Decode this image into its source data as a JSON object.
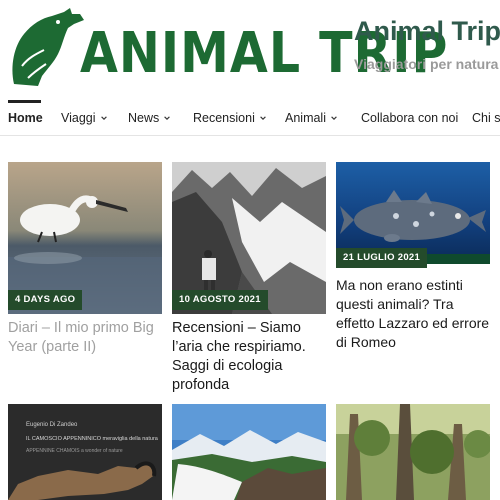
{
  "header": {
    "logo_text": "ANIMAL TRIP",
    "site_title": "Animal Trip",
    "tagline": "Viaggiatori per natura"
  },
  "nav": {
    "items": [
      {
        "label": "Home",
        "active": true,
        "dropdown": false
      },
      {
        "label": "Viaggi",
        "dropdown": true
      },
      {
        "label": "News",
        "dropdown": true
      },
      {
        "label": "Recensioni",
        "dropdown": true
      },
      {
        "label": "Animali",
        "dropdown": true
      },
      {
        "label": "Collabora con noi",
        "dropdown": false
      },
      {
        "label": "Chi si",
        "dropdown": false
      }
    ]
  },
  "posts": [
    {
      "badge": "4 DAYS AGO",
      "title": "Diari – Il mio primo Big Year (parte II)",
      "image": "spoonbill"
    },
    {
      "badge": "10 AGOSTO 2021",
      "title": "Recensioni – Siamo l’aria che respiriamo. Saggi di ecologia profonda",
      "image": "mountains-bw"
    },
    {
      "badge": "21 LUGLIO 2021",
      "title": "Ma non erano estinti questi animali? Tra effetto Lazzaro ed errore di Romeo",
      "image": "coelacanth"
    },
    {
      "badge": "",
      "title": "",
      "image": "book-cover",
      "book_author": "Eugenio Di Zandeo",
      "book_title": "IL CAMOSCIO APPENNINICO meraviglia della natura",
      "book_subtitle": "APPENNINE CHAMOIS a wonder of nature"
    },
    {
      "badge": "",
      "title": "",
      "image": "waterfall"
    },
    {
      "badge": "",
      "title": "",
      "image": "forest"
    }
  ],
  "colors": {
    "brand_green": "#1d6a33",
    "badge_bg": "#244b2b",
    "title_color": "#2f5a4c"
  }
}
